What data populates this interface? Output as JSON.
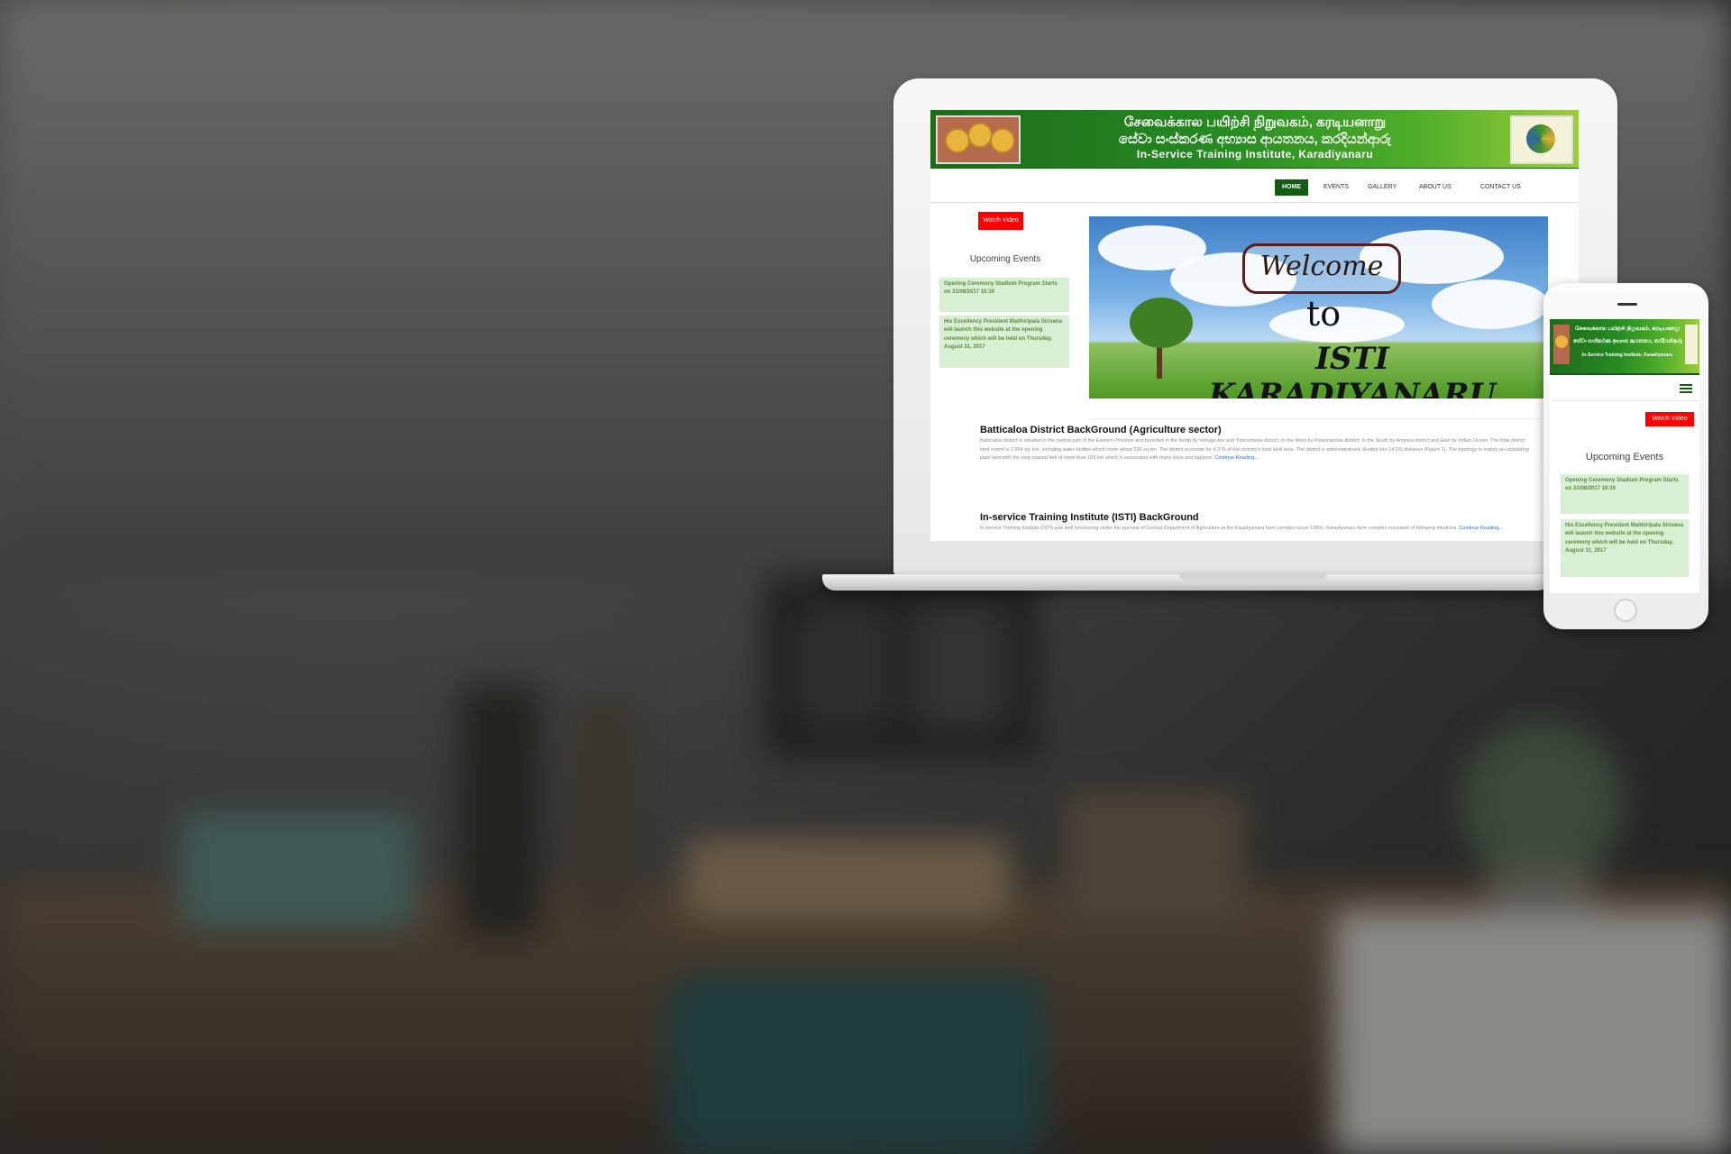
{
  "site": {
    "banner": {
      "tamil": "சேவைக்கால பயிற்சி நிறுவகம், கரடியனாறு",
      "sinhala": "සේවා සංස්කරණ අභ්‍යාස ආයතනය, කරදියන්ආරු",
      "english": "In-Service Training Institute, Karadiyanaru"
    },
    "nav": [
      "HOME",
      "EVENTS",
      "GALLERY",
      "ABOUT US",
      "CONTACT US"
    ],
    "watch_video": "Watch Video",
    "upcoming_title": "Upcoming Events",
    "events": [
      "Opening Ceremony Stadium Program Starts on 31/08/2017 10:30",
      "His Excellency President Maithiripala Sirisena will launch this website at the opening ceremony which will be held on Thursday, August 31, 2017"
    ],
    "hero": {
      "welcome": "Welcome",
      "to": "to",
      "title": "ISTI KARADIYANARU"
    },
    "articles": [
      {
        "title": "Batticaloa District BackGround (Agriculture sector)",
        "body": "Batticaloa district is situated in the central part of the Eastern Province and bounded in the North by Verugal Aru and Trincomalee district, In the West by Polannaruwa district, In the South by Ampara district and East by Indian Ocean. The total district land extent is 2,854 sq. km. including water bodies which cover about 229 sq.km. The district accounts for 4.3 % of the country's total land area. The district is administratively divided into 14 DS divisions (Figure 1). The topology is mainly an undulating plain land with the long coastal belt of more than 100 km which is associated with many bays and lagoons.",
        "link": "Continue Reading..."
      },
      {
        "title": "In-service Training Institute (ISTI) BackGround",
        "body": "In-service Training Institute (ISTI) was well functioning under the purview of Central Department of Agriculture at the Karadiyanaru farm complex since 1980s. Karadiyanaru farm complex consisted of following intuitions.",
        "link": "Continue Reading..."
      }
    ]
  },
  "icons": {
    "menu": "hamburger-menu-icon"
  },
  "colors": {
    "banner_green": "#1e6b1a",
    "nav_active": "#145c12",
    "watch_button": "#ff0000",
    "event_bg": "#d9efd3",
    "link": "#2f6fc4"
  }
}
